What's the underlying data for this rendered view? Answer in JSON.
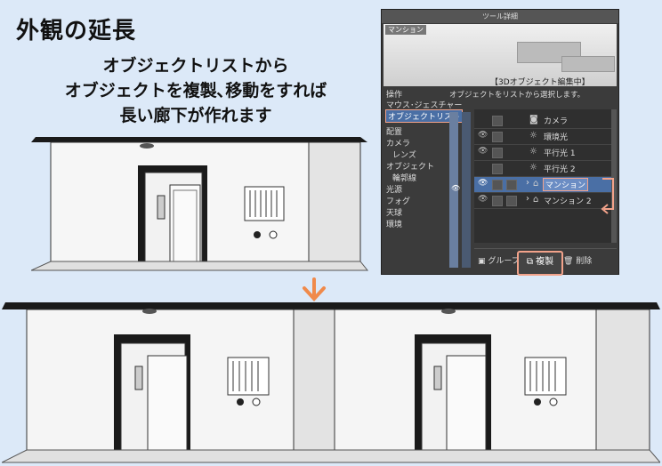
{
  "heading": {
    "title": "外観の延長"
  },
  "caption": {
    "lines": [
      "オブジェクトリストから",
      "オブジェクトを複製､移動をすれば",
      "長い廊下が作れます"
    ]
  },
  "panel": {
    "titlebar": "ツール詳細",
    "preview_name": "マンション",
    "preview_status": "【3Dオブジェクト編集中】",
    "hint": "オブジェクトをリストから選択します。",
    "menu": [
      {
        "label": "操作",
        "sub": false,
        "active": false
      },
      {
        "label": "マウス･ジェスチャー",
        "sub": false,
        "active": false
      },
      {
        "label": "オブジェクトリスト",
        "sub": false,
        "active": true
      },
      {
        "label": "配置",
        "sub": false,
        "active": false
      },
      {
        "label": "カメラ",
        "sub": false,
        "active": false
      },
      {
        "label": "レンズ",
        "sub": true,
        "active": false
      },
      {
        "label": "オブジェクト",
        "sub": false,
        "active": false
      },
      {
        "label": "輪郭線",
        "sub": true,
        "active": false
      },
      {
        "label": "光源",
        "sub": false,
        "active": false
      },
      {
        "label": "フォグ",
        "sub": false,
        "active": false
      },
      {
        "label": "天球",
        "sub": false,
        "active": false
      },
      {
        "label": "環境",
        "sub": false,
        "active": false
      }
    ],
    "objects": [
      {
        "label": "カメラ",
        "icon": "camera-icon",
        "eye": false,
        "caret": false,
        "selected": false
      },
      {
        "label": "環境光",
        "icon": "light-icon",
        "eye": true,
        "caret": false,
        "selected": false
      },
      {
        "label": "平行光 1",
        "icon": "light-icon",
        "eye": true,
        "caret": false,
        "selected": false
      },
      {
        "label": "平行光 2",
        "icon": "light-icon",
        "eye": false,
        "caret": false,
        "selected": false
      },
      {
        "label": "マンション",
        "icon": "building-icon",
        "eye": true,
        "caret": true,
        "selected": true
      },
      {
        "label": "マンション 2",
        "icon": "building-icon",
        "eye": true,
        "caret": true,
        "selected": false
      }
    ],
    "buttons": {
      "group": "グループ",
      "duplicate": "複製",
      "delete": "削除"
    }
  },
  "colors": {
    "background": "#dce9f8",
    "highlight": "#f2a28a",
    "arrow": "#f08a4b",
    "selection": "#4a6fa5"
  }
}
